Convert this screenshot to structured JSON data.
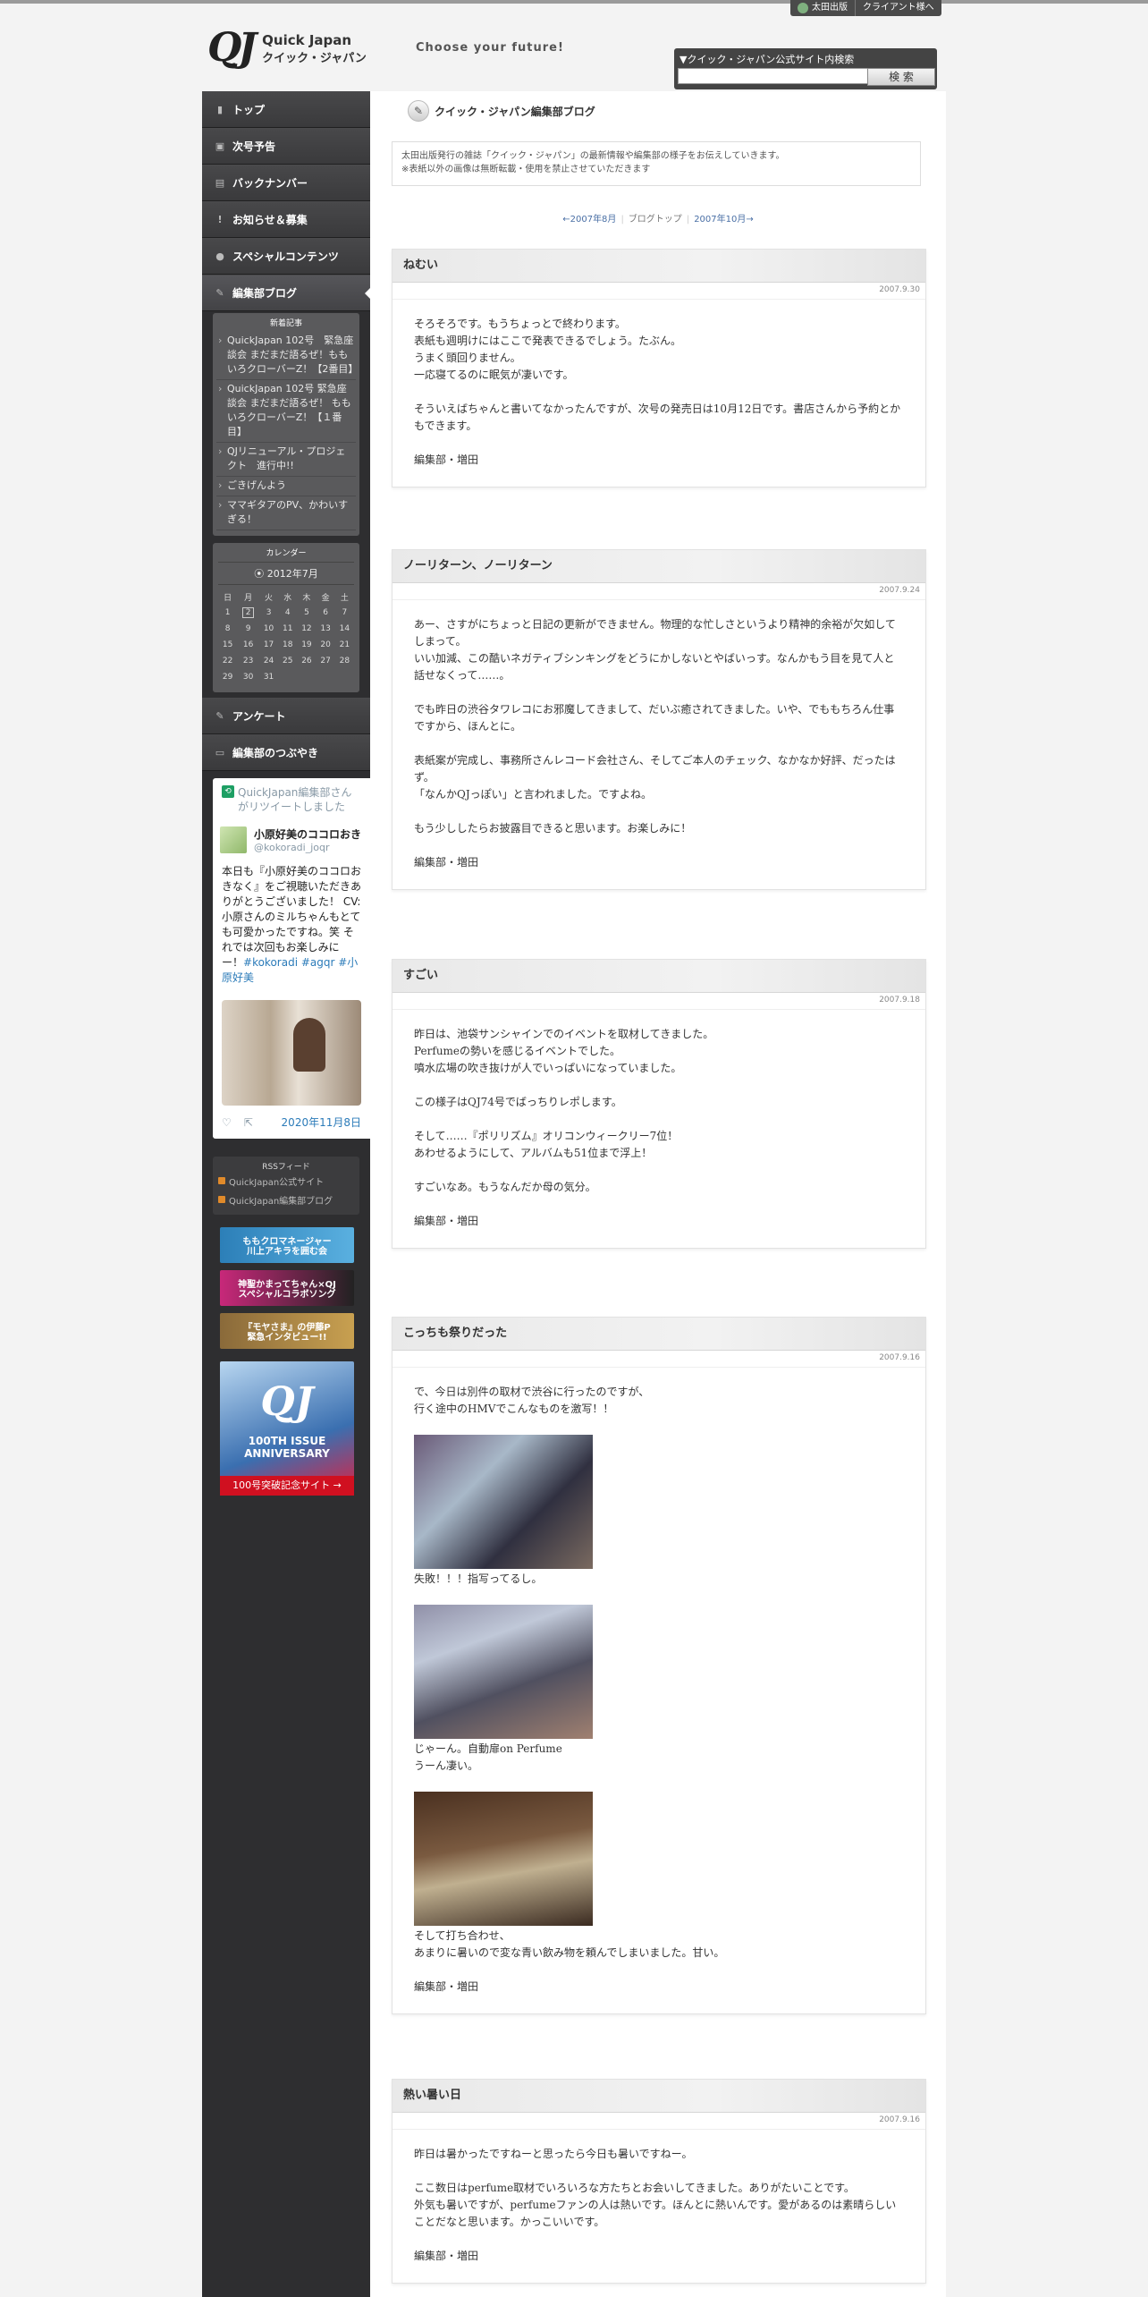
{
  "corp_links": [
    "太田出版",
    "クライアント様へ"
  ],
  "logo": {
    "mark": "QJ",
    "en": "Quick Japan",
    "ja": "クイック・ジャパン"
  },
  "tagline": "Choose your future!",
  "search": {
    "label": "▼クイック・ジャパン公式サイト内検索",
    "value": "",
    "button": "検 索"
  },
  "nav": [
    {
      "label": "トップ",
      "icon": "▮"
    },
    {
      "label": "次号予告",
      "icon": "▣"
    },
    {
      "label": "バックナンバー",
      "icon": "▤"
    },
    {
      "label": "お知らせ＆募集",
      "icon": "!"
    },
    {
      "label": "スペシャルコンテンツ",
      "icon": "●"
    },
    {
      "label": "編集部ブログ",
      "icon": "✎"
    }
  ],
  "recent": {
    "title": "新着記事",
    "items": [
      "QuickJapan 102号　緊急座談会 まだまだ語るぜ！ももいろクローバーZ！【2番目】",
      "QuickJapan 102号 緊急座談会 まだまだ語るぜ！ ももいろクローバーZ！【１番目】",
      "QJリニューアル・プロジェクト　進行中!!",
      "ごきげんよう",
      "ママギタアのPV、かわいすぎる！"
    ]
  },
  "calendar": {
    "title": "カレンダー",
    "month": "2012年7月",
    "weekdays": [
      "日",
      "月",
      "火",
      "水",
      "木",
      "金",
      "土"
    ],
    "weeks": [
      [
        "1",
        "2",
        "3",
        "4",
        "5",
        "6",
        "7"
      ],
      [
        "8",
        "9",
        "10",
        "11",
        "12",
        "13",
        "14"
      ],
      [
        "15",
        "16",
        "17",
        "18",
        "19",
        "20",
        "21"
      ],
      [
        "22",
        "23",
        "24",
        "25",
        "26",
        "27",
        "28"
      ],
      [
        "29",
        "30",
        "31",
        "",
        "",
        "",
        ""
      ]
    ],
    "today": "2"
  },
  "nav2": [
    {
      "label": "アンケート",
      "icon": "✎"
    },
    {
      "label": "編集部のつぶやき",
      "icon": "▭"
    }
  ],
  "tweet": {
    "retweet": "QuickJapan編集部さんがリツイートしました",
    "name": "小原好美のココロおき",
    "handle": "@kokoradi_joqr",
    "text": "本日も『小原好美のココロおきなく』をご視聴いただきありがとうございました！ CV:小原さんのミルちゃんもとても可愛かったですね。笑 それでは次回もお楽しみに ー！",
    "tags": "#kokoradi #agqr #小原好美",
    "date": "2020年11月8日"
  },
  "rss": {
    "title": "RSSフィード",
    "items": [
      "QuickJapan公式サイト",
      "QuickJapan編集部ブログ"
    ]
  },
  "banners": [
    {
      "label": "ももクロマネージャー\n川上アキラを囲む会",
      "color": "#2c7fb8"
    },
    {
      "label": "神聖かまってちゃん×QJ\nスペシャルコラボソング",
      "color": "#c8287a"
    },
    {
      "label": "『モヤさま』の伊藤P\n緊急インタビュー!!",
      "color": "#8a6a3a"
    }
  ],
  "anniversary": {
    "logo": "QJ",
    "text": "100TH ISSUE\nANNIVERSARY",
    "link": "100号突破記念サイト →"
  },
  "blog": {
    "title": "クイック・ジャパン編集部ブログ",
    "intro": [
      "太田出版発行の雑誌「クイック・ジャパン」の最新情報や編集部の様子をお伝えしていきます。",
      "※表紙以外の画像は無断転載・使用を禁止させていただきます"
    ],
    "pager": {
      "prev": "←2007年8月",
      "top": "ブログトップ",
      "next": "2007年10月→"
    }
  },
  "entries": [
    {
      "title": "ねむい",
      "date": "2007.9.30",
      "paragraphs": [
        "そろそろです。もうちょっとで終わります。\n表紙も週明けにはここで発表できるでしょう。たぶん。\nうまく頭回りません。\n一応寝てるのに眠気が凄いです。",
        "そういえばちゃんと書いてなかったんですが、次号の発売日は10月12日です。書店さんから予約とかもできます。",
        "編集部・増田"
      ]
    },
    {
      "title": "ノーリターン、ノーリターン",
      "date": "2007.9.24",
      "paragraphs": [
        "あー、さすがにちょっと日記の更新ができません。物理的な忙しさというより精神的余裕が欠如してしまって。\nいい加減、この酷いネガティブシンキングをどうにかしないとやばいっす。なんかもう目を見て人と話せなくって……。",
        "でも昨日の渋谷タワレコにお邪魔してきまして、だいぶ癒されてきました。いや、でももちろん仕事ですから、ほんとに。",
        "表紙案が完成し、事務所さんレコード会社さん、そしてご本人のチェック、なかなか好評、だったはず。\n「なんかQJっぽい」と言われました。ですよね。",
        "もう少ししたらお披露目できると思います。お楽しみに！",
        "編集部・増田"
      ]
    },
    {
      "title": "すごい",
      "date": "2007.9.18",
      "paragraphs": [
        "昨日は、池袋サンシャインでのイベントを取材してきました。\nPerfumeの勢いを感じるイベントでした。\n噴水広場の吹き抜けが人でいっぱいになっていました。",
        "この様子はQJ74号でばっちりレポします。",
        "そして……『ポリリズム』オリコンウィークリー7位！\nあわせるようにして、アルバムも51位まで浮上！",
        "すごいなあ。もうなんだか母の気分。",
        "編集部・増田"
      ]
    },
    {
      "title": "こっちも祭りだった",
      "date": "2007.9.16",
      "intro": "で、今日は別件の取材で渋谷に行ったのですが、\n行く途中のHMVでこんなものを激写！！",
      "photo_captions": [
        "失敗！！！指写ってるし。",
        "じゃーん。自動扉on Perfume\nうーん凄い。",
        "そして打ち合わせ、\nあまりに暑いので変な青い飲み物を頼んでしまいました。甘い。"
      ],
      "sign": "編集部・増田"
    },
    {
      "title": "熱い暑い日",
      "date": "2007.9.16",
      "paragraphs": [
        "昨日は暑かったですねーと思ったら今日も暑いですねー。",
        "ここ数日はperfume取材でいろいろな方たちとお会いしてきました。ありがたいことです。\n外気も暑いですが、perfumeファンの人は熱いです。ほんとに熱いんです。愛があるのは素晴らしいことだなと思います。かっこいいです。",
        "編集部・増田"
      ]
    }
  ]
}
